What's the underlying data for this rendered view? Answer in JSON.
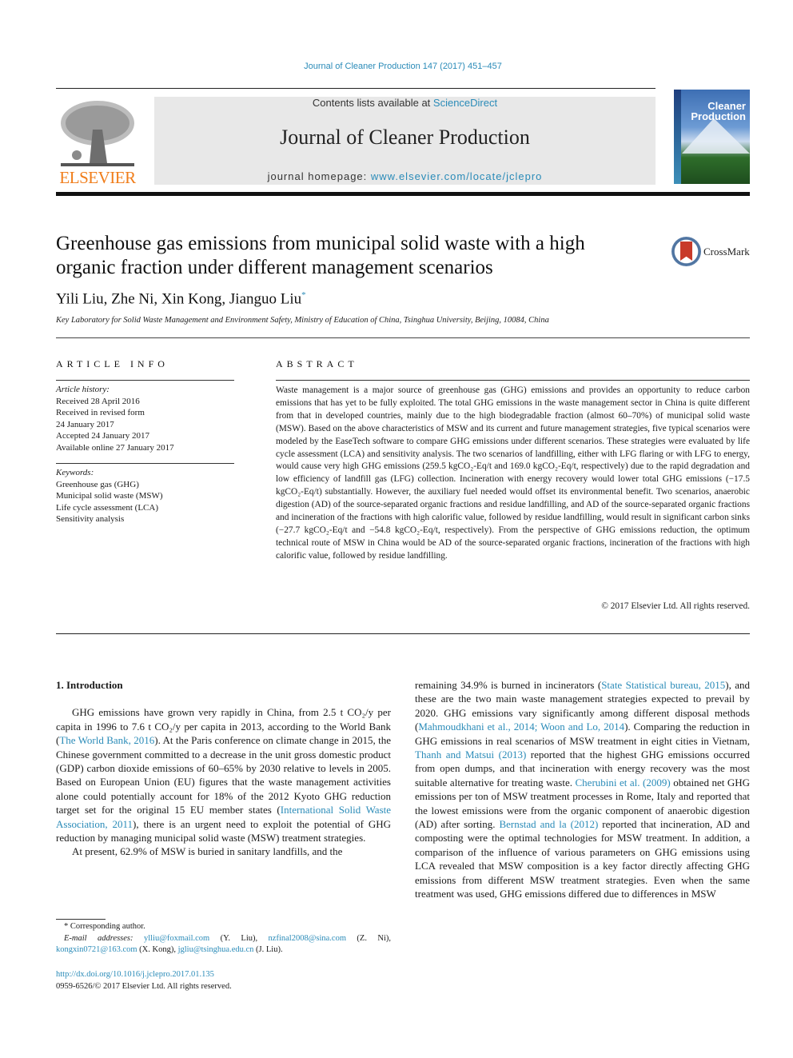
{
  "header": {
    "journal_reference": "Journal of Cleaner Production 147 (2017) 451–457",
    "contents_prefix": "Contents lists available at ",
    "contents_link": "ScienceDirect",
    "journal_name": "Journal of Cleaner Production",
    "homepage_prefix": "journal homepage: ",
    "homepage_link": "www.elsevier.com/locate/jclepro",
    "publisher_logo_text": "ELSEVIER",
    "cover_title_line1": "Cleaner",
    "cover_title_line2": "Production",
    "colors": {
      "link": "#2a8bb8",
      "elsevier_orange": "#f07d1a",
      "band": "#e8e8e8"
    }
  },
  "article": {
    "title": "Greenhouse gas emissions from municipal solid waste with a high organic fraction under different management scenarios",
    "crossmark_label": "CrossMark",
    "authors": "Yili Liu, Zhe Ni, Xin Kong, Jianguo Liu",
    "corresponding_marker": "*",
    "affiliation": "Key Laboratory for Solid Waste Management and Environment Safety, Ministry of Education of China, Tsinghua University, Beijing, 10084, China"
  },
  "article_info": {
    "heading": "ARTICLE INFO",
    "history_label": "Article history:",
    "history": [
      "Received 28 April 2016",
      "Received in revised form",
      "24 January 2017",
      "Accepted 24 January 2017",
      "Available online 27 January 2017"
    ],
    "keywords_label": "Keywords:",
    "keywords": [
      "Greenhouse gas (GHG)",
      "Municipal solid waste (MSW)",
      "Life cycle assessment (LCA)",
      "Sensitivity analysis"
    ]
  },
  "abstract": {
    "heading": "ABSTRACT",
    "text": "Waste management is a major source of greenhouse gas (GHG) emissions and provides an opportunity to reduce carbon emissions that has yet to be fully exploited. The total GHG emissions in the waste management sector in China is quite different from that in developed countries, mainly due to the high biodegradable fraction (almost 60–70%) of municipal solid waste (MSW). Based on the above characteristics of MSW and its current and future management strategies, five typical scenarios were modeled by the EaseTech software to compare GHG emissions under different scenarios. These strategies were evaluated by life cycle assessment (LCA) and sensitivity analysis. The two scenarios of landfilling, either with LFG flaring or with LFG to energy, would cause very high GHG emissions (259.5 kgCO₂-Eq/t and 169.0 kgCO₂-Eq/t, respectively) due to the rapid degradation and low efficiency of landfill gas (LFG) collection. Incineration with energy recovery would lower total GHG emissions (−17.5 kgCO₂-Eq/t) substantially. However, the auxiliary fuel needed would offset its environmental benefit. Two scenarios, anaerobic digestion (AD) of the source-separated organic fractions and residue landfilling, and AD of the source-separated organic fractions and incineration of the fractions with high calorific value, followed by residue landfilling, would result in significant carbon sinks (−27.7 kgCO₂-Eq/t and −54.8 kgCO₂-Eq/t, respectively). From the perspective of GHG emissions reduction, the optimum technical route of MSW in China would be AD of the source-separated organic fractions, incineration of the fractions with high calorific value, followed by residue landfilling.",
    "copyright": "© 2017 Elsevier Ltd. All rights reserved."
  },
  "body": {
    "section_heading": "1.  Introduction",
    "left": {
      "p1_a": "GHG emissions have grown very rapidly in China, from 2.5 t CO₂/y per capita in 1996 to 7.6 t CO₂/y per capita in 2013, according to the World Bank (",
      "p1_cite1": "The World Bank, 2016",
      "p1_b": "). At the Paris conference on climate change in 2015, the Chinese government committed to a decrease in the unit gross domestic product (GDP) carbon dioxide emissions of 60–65% by 2030 relative to levels in 2005. Based on European Union (EU) figures that the waste management activities alone could potentially account for 18% of the 2012 Kyoto GHG reduction target set for the original 15 EU member states (",
      "p1_cite2": "International Solid Waste Association, 2011",
      "p1_c": "), there is an urgent need to exploit the potential of GHG reduction by managing municipal solid waste (MSW) treatment strategies.",
      "p2": "At present, 62.9% of MSW is buried in sanitary landfills, and the"
    },
    "right": {
      "a": "remaining 34.9% is burned in incinerators (",
      "cite1": "State Statistical bureau, 2015",
      "b": "), and these are the two main waste management strategies expected to prevail by 2020. GHG emissions vary significantly among different disposal methods (",
      "cite2": "Mahmoudkhani et al., 2014; Woon and Lo, 2014",
      "c": "). Comparing the reduction in GHG emissions in real scenarios of MSW treatment in eight cities in Vietnam, ",
      "cite3": "Thanh and Matsui (2013)",
      "d": " reported that the highest GHG emissions occurred from open dumps, and that incineration with energy recovery was the most suitable alternative for treating waste. ",
      "cite4": "Cherubini et al. (2009)",
      "e": " obtained net GHG emissions per ton of MSW treatment processes in Rome, Italy and reported that the lowest emissions were from the organic component of anaerobic digestion (AD) after sorting. ",
      "cite5": "Bernstad and la (2012)",
      "f": " reported that incineration, AD and composting were the optimal technologies for MSW treatment. In addition, a comparison of the influence of various parameters on GHG emissions using LCA revealed that MSW composition is a key factor directly affecting GHG emissions from different MSW treatment strategies. Even when the same treatment was used, GHG emissions differed due to differences in MSW"
    }
  },
  "footnote": {
    "corresponding": "* Corresponding author.",
    "email_label": "E-mail addresses: ",
    "emails": [
      {
        "address": "ylliu@foxmail.com",
        "name": " (Y. Liu), "
      },
      {
        "address": "nzfinal2008@sina.com",
        "name": " (Z. Ni), "
      },
      {
        "address": "kongxin0721@163.com",
        "name": " (X. Kong), "
      },
      {
        "address": "jgliu@tsinghua.edu.cn",
        "name": " (J. Liu)."
      }
    ],
    "doi": "http://dx.doi.org/10.1016/j.jclepro.2017.01.135",
    "issn": "0959-6526/© 2017 Elsevier Ltd. All rights reserved."
  }
}
